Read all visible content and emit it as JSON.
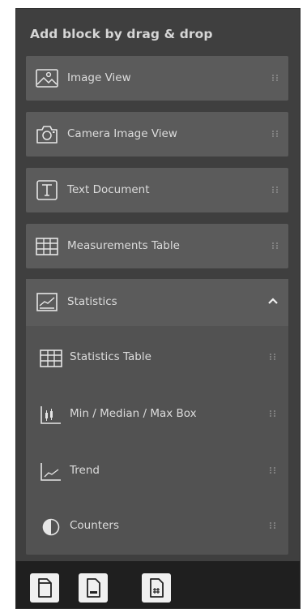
{
  "panel": {
    "title": "Add block by drag & drop"
  },
  "blocks": [
    {
      "label": "Image View",
      "icon": "image-icon"
    },
    {
      "label": "Camera Image View",
      "icon": "camera-icon"
    },
    {
      "label": "Text Document",
      "icon": "text-document-icon"
    },
    {
      "label": "Measurements Table",
      "icon": "table-icon"
    }
  ],
  "statistics": {
    "label": "Statistics",
    "icon": "statistics-chart-icon",
    "expanded": true,
    "items": [
      {
        "label": "Statistics Table",
        "icon": "table-icon"
      },
      {
        "label": "Min / Median / Max Box",
        "icon": "box-plot-icon"
      },
      {
        "label": "Trend",
        "icon": "trend-icon"
      },
      {
        "label": "Counters",
        "icon": "counters-icon"
      }
    ]
  },
  "footer": {
    "buttons": [
      {
        "icon": "page-icon"
      },
      {
        "icon": "page-footer-icon"
      },
      {
        "icon": "page-number-icon"
      }
    ]
  },
  "colors": {
    "panel_bg": "#3f3f3f",
    "card_bg": "#5b5b5b",
    "group_bg": "#525252",
    "footer_bg": "#1f1f1f",
    "text": "#dcdcdc"
  }
}
